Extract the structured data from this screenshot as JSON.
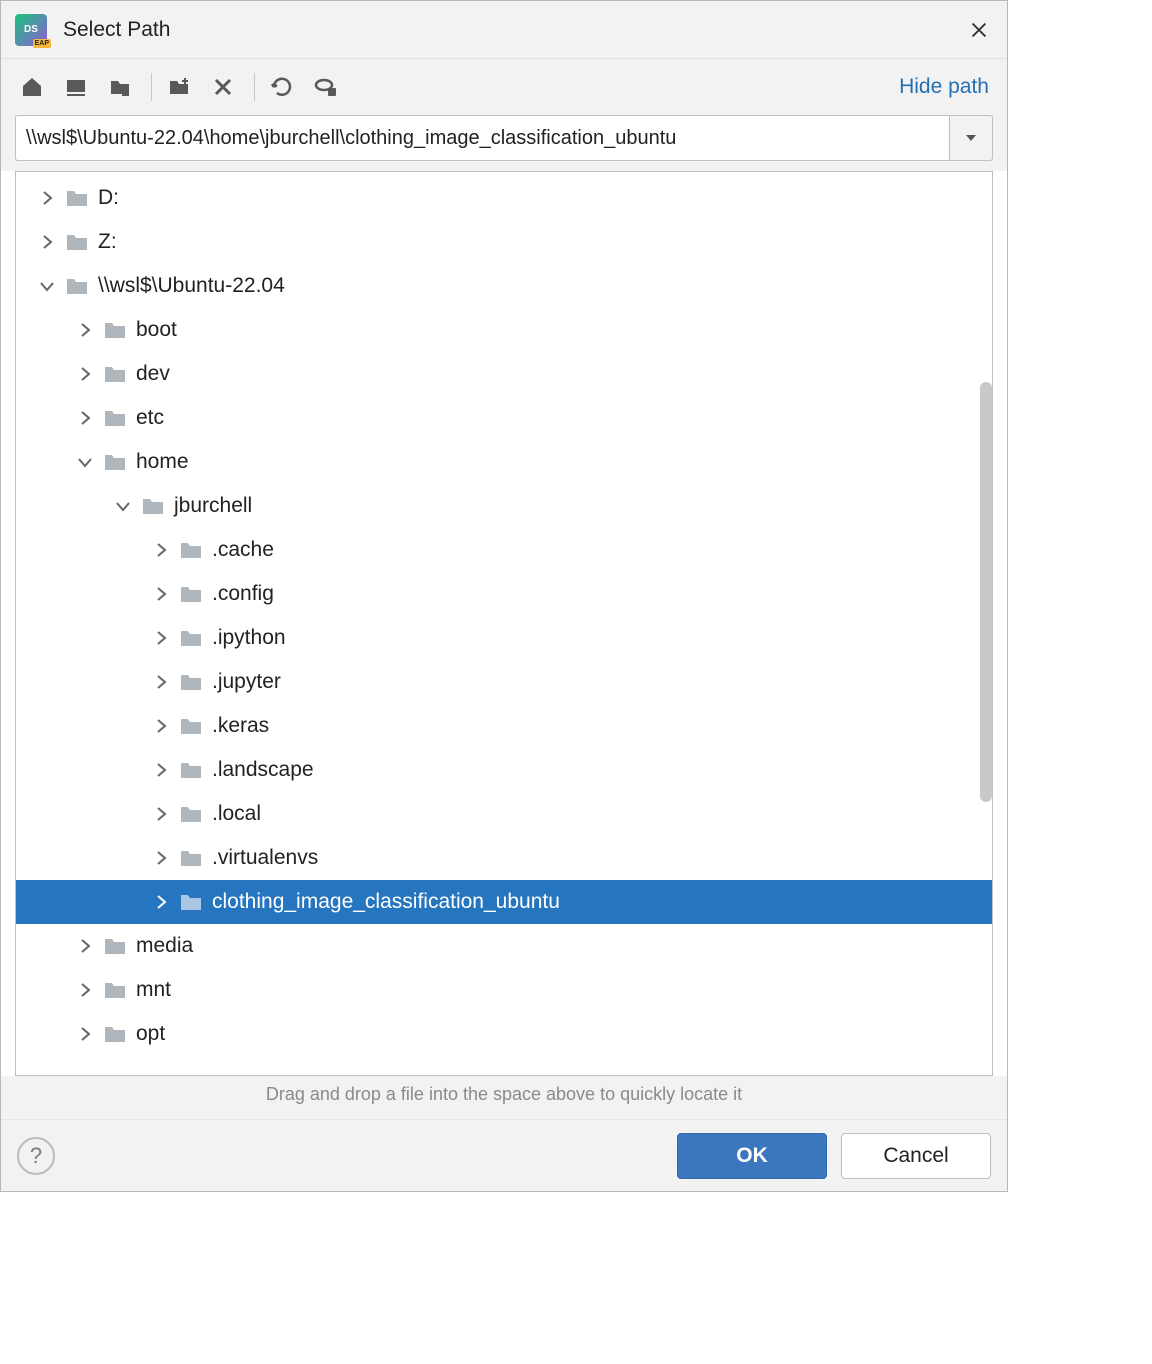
{
  "dialog": {
    "title": "Select Path",
    "hide_path": "Hide path",
    "path_value": "\\\\wsl$\\Ubuntu-22.04\\home\\jburchell\\clothing_image_classification_ubuntu",
    "hint": "Drag and drop a file into the space above to quickly locate it",
    "ok": "OK",
    "cancel": "Cancel",
    "help": "?"
  },
  "toolbar_icons": [
    "home",
    "desktop",
    "project",
    "new-folder",
    "delete",
    "refresh",
    "show-hidden"
  ],
  "tree": [
    {
      "depth": 0,
      "expand": "closed",
      "label": "D:"
    },
    {
      "depth": 0,
      "expand": "closed",
      "label": "Z:"
    },
    {
      "depth": 0,
      "expand": "open",
      "label": "\\\\wsl$\\Ubuntu-22.04"
    },
    {
      "depth": 1,
      "expand": "closed",
      "label": "boot"
    },
    {
      "depth": 1,
      "expand": "closed",
      "label": "dev"
    },
    {
      "depth": 1,
      "expand": "closed",
      "label": "etc"
    },
    {
      "depth": 1,
      "expand": "open",
      "label": "home"
    },
    {
      "depth": 2,
      "expand": "open",
      "label": "jburchell"
    },
    {
      "depth": 3,
      "expand": "closed",
      "label": ".cache"
    },
    {
      "depth": 3,
      "expand": "closed",
      "label": ".config"
    },
    {
      "depth": 3,
      "expand": "closed",
      "label": ".ipython"
    },
    {
      "depth": 3,
      "expand": "closed",
      "label": ".jupyter"
    },
    {
      "depth": 3,
      "expand": "closed",
      "label": ".keras"
    },
    {
      "depth": 3,
      "expand": "closed",
      "label": ".landscape"
    },
    {
      "depth": 3,
      "expand": "closed",
      "label": ".local"
    },
    {
      "depth": 3,
      "expand": "closed",
      "label": ".virtualenvs"
    },
    {
      "depth": 3,
      "expand": "closed",
      "label": "clothing_image_classification_ubuntu",
      "selected": true
    },
    {
      "depth": 1,
      "expand": "closed",
      "label": "media"
    },
    {
      "depth": 1,
      "expand": "closed",
      "label": "mnt"
    },
    {
      "depth": 1,
      "expand": "closed",
      "label": "opt"
    }
  ]
}
